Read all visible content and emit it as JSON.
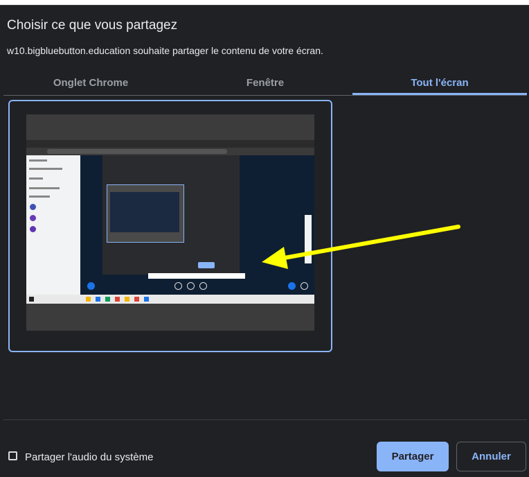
{
  "dialog": {
    "title": "Choisir ce que vous partagez",
    "subtitle": "w10.bigbluebutton.education souhaite partager le contenu de votre écran."
  },
  "tabs": [
    {
      "label": "Onglet Chrome",
      "active": false
    },
    {
      "label": "Fenêtre",
      "active": false
    },
    {
      "label": "Tout l'écran",
      "active": true
    }
  ],
  "footer": {
    "audio_label": "Partager l'audio du système",
    "audio_checked": false,
    "share_label": "Partager",
    "cancel_label": "Annuler"
  },
  "colors": {
    "background": "#202124",
    "accent": "#8ab4f8",
    "annotation_arrow": "#ffff00"
  },
  "icons": {
    "annotation": "yellow-arrow-icon"
  }
}
